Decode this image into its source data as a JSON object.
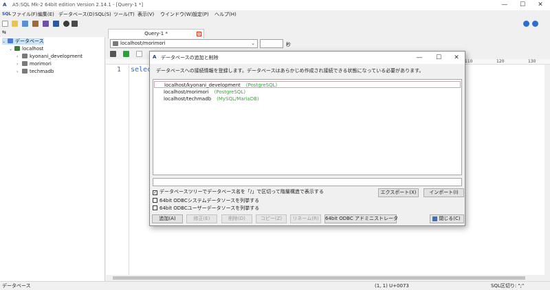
{
  "window": {
    "title": "A5:SQL Mk-2 64bit edition Version 2.14.1 - [Query-1 *]",
    "min": "—",
    "max": "☐",
    "close": "✕"
  },
  "menubar": {
    "sql_icon": "SQL",
    "items": [
      "ファイル(F)",
      "編集(E)",
      "データベース(D)",
      "SQL(S)",
      "ツール(T)",
      "表示(V)",
      "ウインドウ(W)",
      "設定(P)",
      "ヘルプ(H)"
    ]
  },
  "tree": {
    "root": "データベース",
    "host": "localhost",
    "databases": [
      "kyonani_development",
      "morimori",
      "techmadb"
    ]
  },
  "editor": {
    "tab_label": "Query-1 *",
    "tab_close": "x",
    "connection": "localhost/morimori",
    "line_number": "1",
    "code": "select",
    "ruler": [
      "110",
      "120",
      "130"
    ]
  },
  "statusbar": {
    "left": "データベース",
    "position": "(1, 1) U+0073",
    "sql_sep": "SQL区切り: \";\""
  },
  "dialog": {
    "title": "データベースの追加と削除",
    "description": "データベースへの接続情報を登録します。データベースはあらかじめ作成され接続できる状態になっている必要があります。",
    "databases": [
      {
        "name": "localhost/kyonani_development",
        "type": "(PostgreSQL)"
      },
      {
        "name": "localhost/morimori",
        "type": "(PostgreSQL)"
      },
      {
        "name": "localhost/techmadb",
        "type": "(MySQL/MariaDB)"
      }
    ],
    "checkbox_tree": "データベースツリーでデータベース名を「/」で区切って階層構造で表示する",
    "checkbox_tree_checked": "✓",
    "checkbox_odbc_system": "64bit ODBCシステムデータソースを列挙する",
    "checkbox_odbc_user": "64bit ODBCユーザーデータソースを列挙する",
    "btn_export": "エクスポート(X)",
    "btn_import": "インポート(I)",
    "btn_add": "追加(A)",
    "btn_edit": "修正(E)",
    "btn_delete": "削除(D)",
    "btn_copy": "コピー(Z)",
    "btn_rename": "リネーム(R)",
    "btn_odbc_admin": "64bit ODBC アドミニストレータ",
    "btn_close": "閉じる(C)",
    "min": "—",
    "max": "☐",
    "close": "✕"
  },
  "colors": {
    "accent": "#2b6fd1",
    "db_type": "#3aa53a"
  }
}
